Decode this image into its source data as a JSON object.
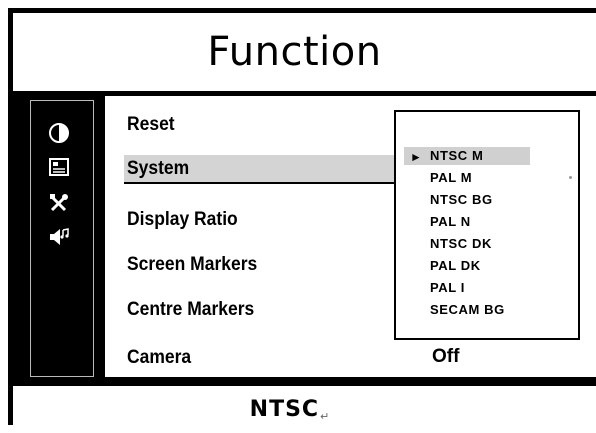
{
  "title": "Function",
  "sidebar": {
    "icons": [
      "contrast-icon",
      "picture-settings-icon",
      "tools-icon",
      "audio-icon"
    ]
  },
  "menu": {
    "items": [
      {
        "label": "Reset"
      },
      {
        "label": "System"
      },
      {
        "label": "Display Ratio"
      },
      {
        "label": "Screen Markers"
      },
      {
        "label": "Centre Markers"
      },
      {
        "label": "Camera"
      }
    ],
    "selected": "System",
    "camera_value": "Off"
  },
  "system_dropdown": {
    "options": [
      "NTSC M",
      "PAL M",
      "NTSC BG",
      "PAL N",
      "NTSC DK",
      "PAL DK",
      "PAL I",
      "SECAM BG"
    ],
    "selected": "NTSC M",
    "selected_marker": "►"
  },
  "status": {
    "text": "NTSC",
    "mark": "↵"
  },
  "colors": {
    "frame": "#000000",
    "background": "#ffffff",
    "highlight": "#d0d0d0"
  }
}
